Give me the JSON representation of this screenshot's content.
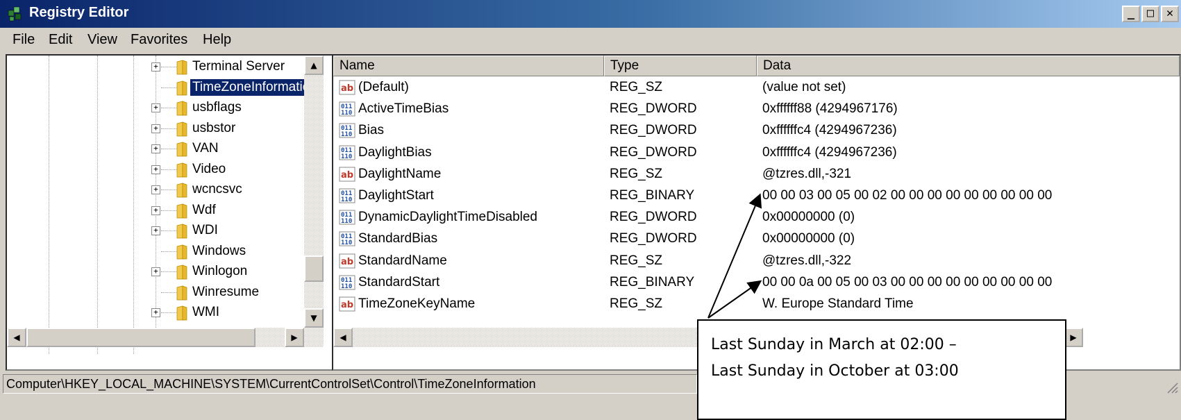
{
  "window": {
    "title": "Registry Editor",
    "controls": {
      "minimize": "_",
      "maximize": "□",
      "close": "✕"
    }
  },
  "menu": [
    {
      "label": "File"
    },
    {
      "label": "Edit"
    },
    {
      "label": "View"
    },
    {
      "label": "Favorites"
    },
    {
      "label": "Help"
    }
  ],
  "tree": {
    "items": [
      {
        "label": "Terminal Server",
        "expander": "+",
        "selected": false
      },
      {
        "label": "TimeZoneInformation",
        "expander": "",
        "selected": true
      },
      {
        "label": "usbflags",
        "expander": "+",
        "selected": false
      },
      {
        "label": "usbstor",
        "expander": "+",
        "selected": false
      },
      {
        "label": "VAN",
        "expander": "+",
        "selected": false
      },
      {
        "label": "Video",
        "expander": "+",
        "selected": false
      },
      {
        "label": "wcncsvc",
        "expander": "+",
        "selected": false
      },
      {
        "label": "Wdf",
        "expander": "+",
        "selected": false
      },
      {
        "label": "WDI",
        "expander": "+",
        "selected": false
      },
      {
        "label": "Windows",
        "expander": "",
        "selected": false
      },
      {
        "label": "Winlogon",
        "expander": "+",
        "selected": false
      },
      {
        "label": "Winresume",
        "expander": "",
        "selected": false
      },
      {
        "label": "WMI",
        "expander": "+",
        "selected": false
      }
    ]
  },
  "list": {
    "columns": {
      "name": "Name",
      "type": "Type",
      "data": "Data"
    },
    "rows": [
      {
        "icon": "string-value-icon",
        "name": "(Default)",
        "type": "REG_SZ",
        "data": "(value not set)"
      },
      {
        "icon": "binary-value-icon",
        "name": "ActiveTimeBias",
        "type": "REG_DWORD",
        "data": "0xffffff88 (4294967176)"
      },
      {
        "icon": "binary-value-icon",
        "name": "Bias",
        "type": "REG_DWORD",
        "data": "0xffffffc4 (4294967236)"
      },
      {
        "icon": "binary-value-icon",
        "name": "DaylightBias",
        "type": "REG_DWORD",
        "data": "0xffffffc4 (4294967236)"
      },
      {
        "icon": "string-value-icon",
        "name": "DaylightName",
        "type": "REG_SZ",
        "data": "@tzres.dll,-321"
      },
      {
        "icon": "binary-value-icon",
        "name": "DaylightStart",
        "type": "REG_BINARY",
        "data": "00 00 03 00 05 00 02 00 00 00 00 00 00 00 00 00"
      },
      {
        "icon": "binary-value-icon",
        "name": "DynamicDaylightTimeDisabled",
        "type": "REG_DWORD",
        "data": "0x00000000 (0)"
      },
      {
        "icon": "binary-value-icon",
        "name": "StandardBias",
        "type": "REG_DWORD",
        "data": "0x00000000 (0)"
      },
      {
        "icon": "string-value-icon",
        "name": "StandardName",
        "type": "REG_SZ",
        "data": "@tzres.dll,-322"
      },
      {
        "icon": "binary-value-icon",
        "name": "StandardStart",
        "type": "REG_BINARY",
        "data": "00 00 0a 00 05 00 03 00 00 00 00 00 00 00 00 00"
      },
      {
        "icon": "string-value-icon",
        "name": "TimeZoneKeyName",
        "type": "REG_SZ",
        "data": "W. Europe Standard Time"
      }
    ]
  },
  "statusbar": {
    "path": "Computer\\HKEY_LOCAL_MACHINE\\SYSTEM\\CurrentControlSet\\Control\\TimeZoneInformation"
  },
  "callout": {
    "line1": "Last Sunday in March at 02:00 –",
    "line2": "Last Sunday in October at 03:00"
  },
  "colors": {
    "selection": "#0a246a",
    "window_face": "#d4d0c8",
    "folder": "#f2c94c",
    "string_icon": "#c0392b",
    "binary_icon": "#1f4fa3"
  }
}
